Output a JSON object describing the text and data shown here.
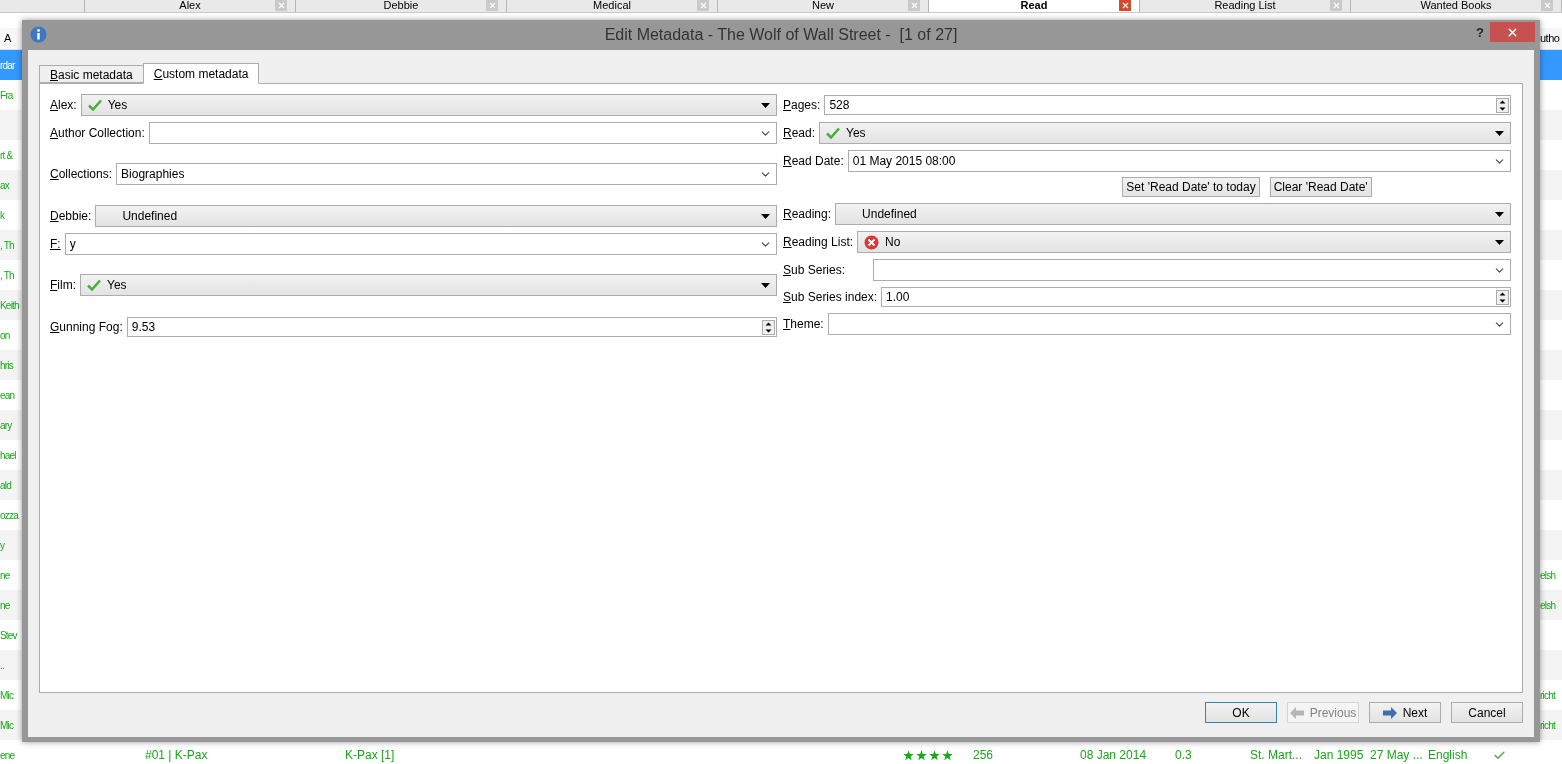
{
  "library_tabs": [
    {
      "label": "Alex",
      "selected": false
    },
    {
      "label": "Debbie",
      "selected": false
    },
    {
      "label": "Medical",
      "selected": false
    },
    {
      "label": "New",
      "selected": false
    },
    {
      "label": "Read",
      "selected": true
    },
    {
      "label": "Reading List",
      "selected": false
    },
    {
      "label": "Wanted Books",
      "selected": false
    }
  ],
  "library_table": {
    "header": {
      "column_1": "A",
      "column_13": "utho"
    },
    "rows": [
      {
        "selected": true,
        "column_1": "rdar"
      },
      {
        "selected": false,
        "column_1": "Fra"
      },
      {
        "selected": false
      },
      {
        "selected": false,
        "column_1": "rt &"
      },
      {
        "selected": false,
        "column_1": "ax"
      },
      {
        "selected": false,
        "column_1": "k"
      },
      {
        "selected": false,
        "column_1": ", Th"
      },
      {
        "selected": false,
        "column_1": ", Th"
      },
      {
        "selected": false,
        "column_1": "Keith"
      },
      {
        "selected": false,
        "column_1": "on"
      },
      {
        "selected": false,
        "column_1": "hris"
      },
      {
        "selected": false,
        "column_1": "ean"
      },
      {
        "selected": false,
        "column_1": "ary"
      },
      {
        "selected": false,
        "column_1": "hael"
      },
      {
        "selected": false,
        "column_1": "ald"
      },
      {
        "selected": false,
        "column_1": "ozza"
      },
      {
        "selected": false,
        "column_1": "y"
      },
      {
        "selected": false,
        "column_1": "ne",
        "column_13": "elsh"
      },
      {
        "selected": false,
        "column_1": "ne",
        "column_13": "elsh"
      },
      {
        "selected": false,
        "column_1": "Stev"
      },
      {
        "selected": false,
        "column_1": ".."
      },
      {
        "selected": false,
        "column_1": "Mic",
        "column_13": "richt"
      },
      {
        "selected": false,
        "column_1": "Mic",
        "column_13": "richt"
      },
      {
        "selected": false,
        "column_1": "ene",
        "column_2": "#01 | K-Pax",
        "column_3": "K-Pax [1]",
        "stars": 4,
        "column_5": "256",
        "column_6": "08 Jan 2014",
        "column_7": "0.3",
        "column_8": "St. Mart...",
        "column_9": "Jan 1995",
        "column_10": "27 May ...",
        "column_11": "English",
        "checked": true
      }
    ]
  },
  "dialog": {
    "title": "Edit Metadata - The Wolf of Wall Street -  [1 of 27]",
    "help_button": "?",
    "tabs": [
      {
        "label": "Basic metadata",
        "selected": false
      },
      {
        "label": "Custom metadata",
        "selected": true
      }
    ],
    "left_fields": [
      {
        "label": "Alex:",
        "kind": "yes_combo",
        "value": "Yes"
      },
      {
        "label": "Author Collection:",
        "kind": "editable"
      },
      {
        "label": "Collections:",
        "kind": "editable",
        "value": "Biographies"
      },
      {
        "label": "Debbie:",
        "kind": "blank_combo",
        "value": "Undefined"
      },
      {
        "label": "F:",
        "kind": "editable",
        "value": "y"
      },
      {
        "label": "Film:",
        "kind": "yes_combo",
        "value": "Yes"
      },
      {
        "label": "Gunning Fog:",
        "kind": "spin",
        "value": "9.53"
      }
    ],
    "right_fields": [
      {
        "label": "Pages:",
        "kind": "spin",
        "value": "528"
      },
      {
        "label": "Read:",
        "kind": "yes_combo",
        "value": "Yes"
      },
      {
        "label": "Read Date:",
        "kind": "editable",
        "value": "01 May 2015 08:00"
      },
      {
        "kind": "buttons",
        "buttons": [
          "Set 'Read Date' to today",
          "Clear 'Read Date'"
        ]
      },
      {
        "label": "Reading:",
        "kind": "blank_combo",
        "value": "Undefined"
      },
      {
        "label": "Reading List:",
        "kind": "no_combo",
        "value": "No"
      },
      {
        "label": "Sub Series:",
        "kind": "editable"
      },
      {
        "label": "Sub Series index:",
        "kind": "spin",
        "value": "1.00"
      },
      {
        "label": "Theme:",
        "kind": "editable"
      }
    ],
    "buttons": [
      {
        "label": "OK",
        "kind": "plain",
        "default": true,
        "disabled": false
      },
      {
        "label": "Previous",
        "kind": "previous",
        "default": false,
        "disabled": true
      },
      {
        "label": "Next",
        "kind": "next",
        "default": false,
        "disabled": false
      },
      {
        "label": "Cancel",
        "kind": "plain",
        "default": false,
        "disabled": false
      }
    ]
  }
}
